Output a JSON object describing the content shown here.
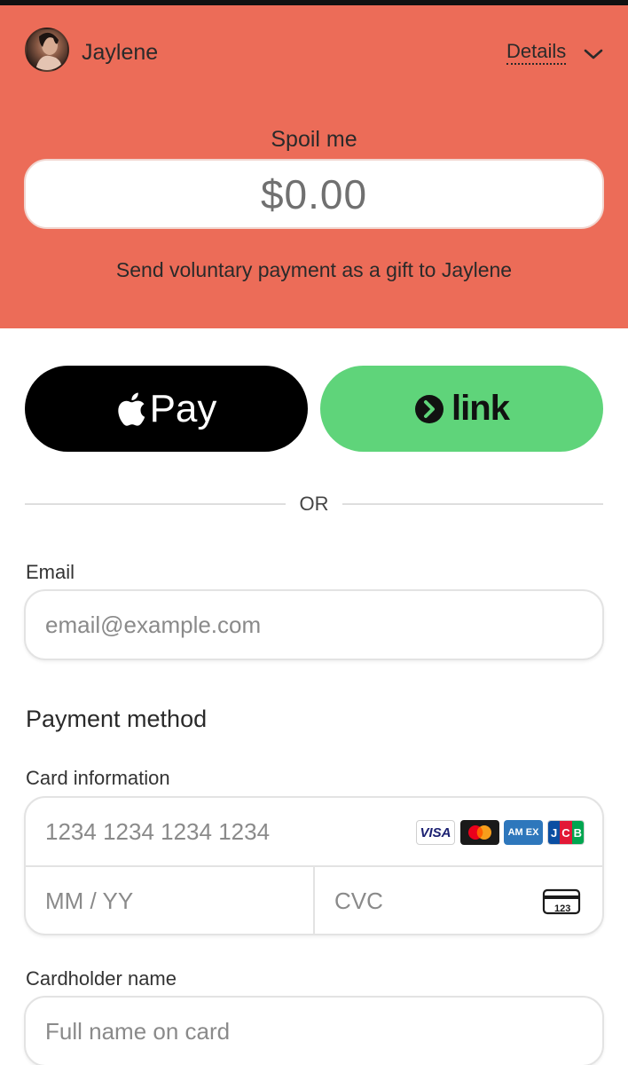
{
  "header": {
    "merchant_name": "Jaylene",
    "details_label": "Details",
    "amount_label": "Spoil me",
    "amount_value": "$0.00",
    "note": "Send voluntary payment as a gift to Jaylene",
    "accent_color": "#ec6c58"
  },
  "wallets": {
    "apple_pay_label": "Pay",
    "link_label": "link",
    "link_color": "#5fd47a"
  },
  "divider_text": "OR",
  "email": {
    "label": "Email",
    "placeholder": "email@example.com"
  },
  "payment": {
    "section_title": "Payment method",
    "card_label": "Card information",
    "card_number_placeholder": "1234 1234 1234 1234",
    "expiry_placeholder": "MM / YY",
    "cvc_placeholder": "CVC",
    "cvc_icon_text": "123",
    "brands": {
      "visa": "VISA",
      "amex": "AM EX",
      "jcb": [
        "J",
        "C",
        "B"
      ]
    }
  },
  "cardholder": {
    "label": "Cardholder name",
    "placeholder": "Full name on card"
  }
}
